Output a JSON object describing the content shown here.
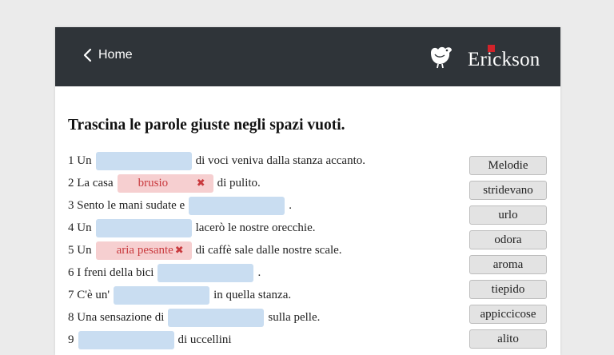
{
  "nav": {
    "back_label": "Home"
  },
  "brand": {
    "name": "Erickson"
  },
  "instructions": "Trascina le parole giuste negli spazi vuoti.",
  "sentences": [
    {
      "before": "1 Un",
      "filled": "",
      "after": "di voci veniva dalla stanza accanto."
    },
    {
      "before": "2 La casa",
      "filled": "brusio",
      "after": "di pulito."
    },
    {
      "before": "3 Sento le mani sudate e",
      "filled": "",
      "after": "."
    },
    {
      "before": "4 Un",
      "filled": "",
      "after": "lacerò le nostre orecchie."
    },
    {
      "before": "5 Un",
      "filled": "aria pesante",
      "after": "di caffè sale dalle nostre scale."
    },
    {
      "before": "6 I freni della bici",
      "filled": "",
      "after": "."
    },
    {
      "before": "7 C'è un'",
      "filled": "",
      "after": "in quella stanza."
    },
    {
      "before": "8 Una sensazione di",
      "filled": "",
      "after": "sulla pelle."
    },
    {
      "before": "9",
      "filled": "",
      "after": "di uccellini"
    }
  ],
  "word_bank": [
    "Melodie",
    "stridevano",
    "urlo",
    "odora",
    "aroma",
    "tiepido",
    "appiccicose",
    "alito"
  ],
  "colors": {
    "header": "#2f3439",
    "blank": "#c9ddf1",
    "wrong": "#f6cfd0",
    "wrong_text": "#c93a3e",
    "brand_red": "#d2232a"
  }
}
